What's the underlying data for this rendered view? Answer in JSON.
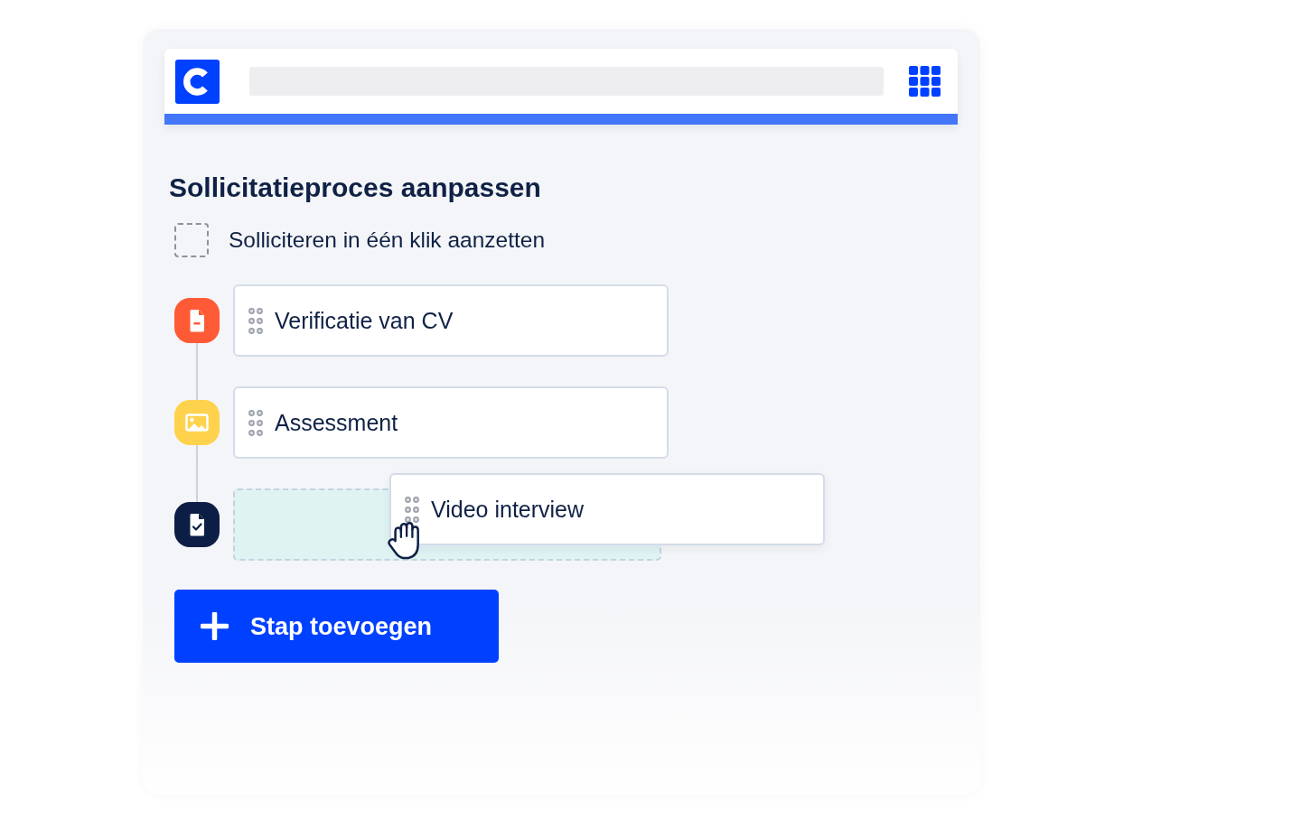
{
  "title": "Sollicitatieproces aanpassen",
  "one_click": {
    "label": "Solliciteren in één klik aanzetten",
    "checked": false
  },
  "steps": [
    {
      "kind": "document",
      "label": "Verificatie van CV",
      "color": "#ff5a36",
      "dragging": false
    },
    {
      "kind": "image",
      "label": "Assessment",
      "color": "#ffd24d",
      "dragging": false
    },
    {
      "kind": "checked-document",
      "label": "Video interview",
      "color": "#0c1e45",
      "dragging": true
    }
  ],
  "add_step_button": {
    "label": "Stap toevoegen"
  }
}
